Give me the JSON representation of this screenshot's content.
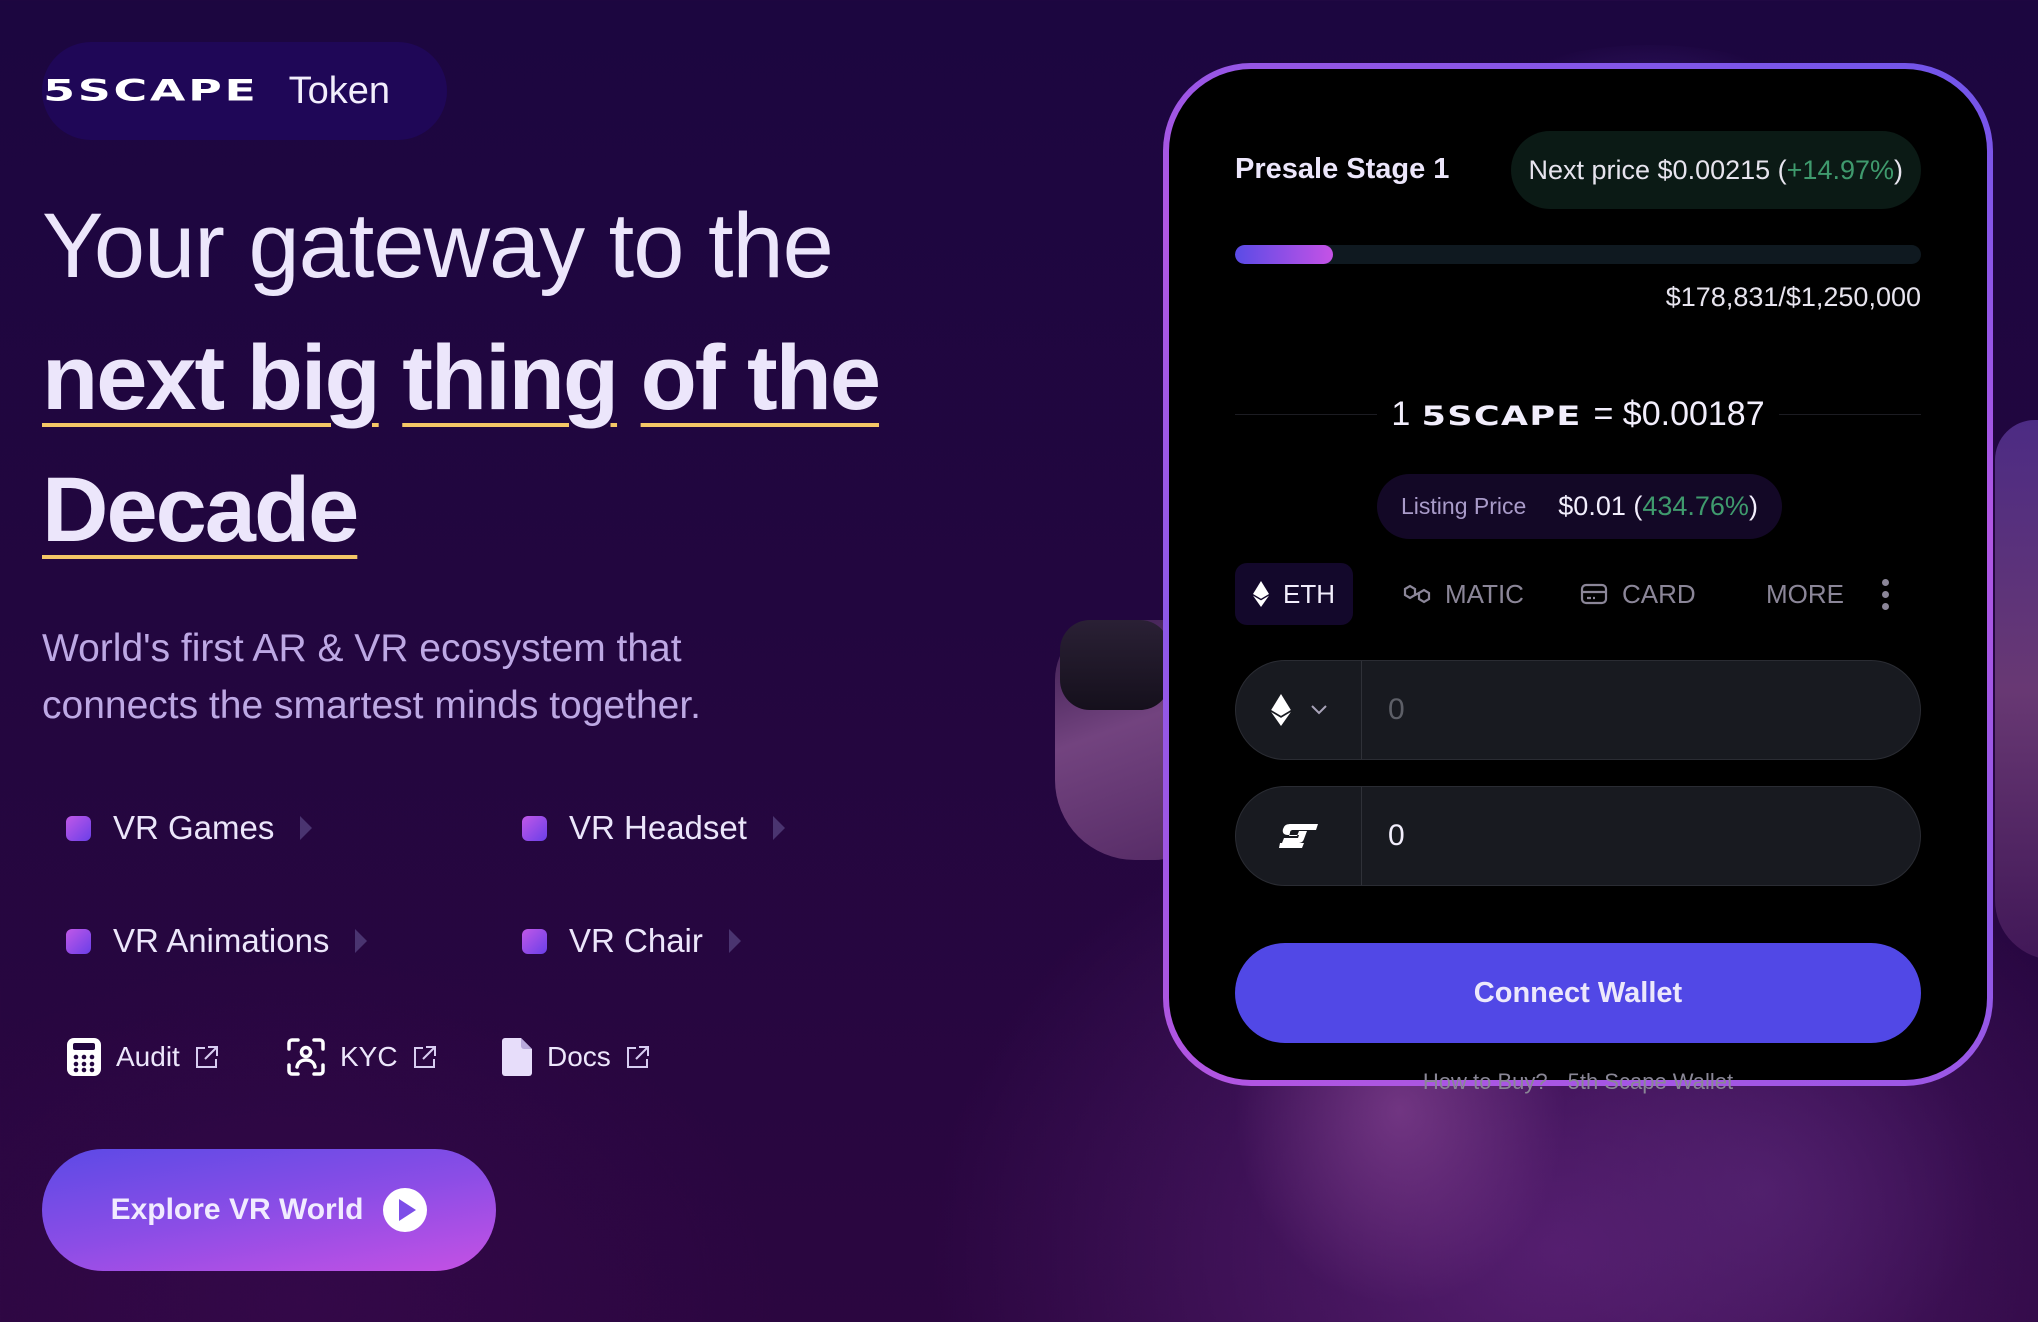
{
  "brand": {
    "logo_mark": "5SCAPE",
    "logo_suffix": "Token"
  },
  "hero": {
    "headline_line1": "Your gateway to the",
    "headline_line2_parts": [
      "next big",
      "thing",
      "of the"
    ],
    "headline_line3": "Decade",
    "description": "World's first AR & VR ecosystem that connects the smartest minds together.",
    "features": [
      {
        "label": "VR Games"
      },
      {
        "label": "VR Headset"
      },
      {
        "label": "VR Animations"
      },
      {
        "label": "VR Chair"
      }
    ],
    "links": [
      {
        "label": "Audit",
        "icon": "calculator-icon"
      },
      {
        "label": "KYC",
        "icon": "face-scan-icon"
      },
      {
        "label": "Docs",
        "icon": "document-icon"
      }
    ],
    "cta_label": "Explore VR World",
    "colors": {
      "underline": "#f4c766",
      "feature_bullet_from": "#c158e8",
      "feature_bullet_to": "#6a3fe8"
    }
  },
  "widget": {
    "stage_title": "Presale Stage 1",
    "next_price_prefix": "Next price $0.00215 (",
    "next_price_change": "+14.97%",
    "next_price_suffix": ")",
    "progress": {
      "raised": 178831,
      "goal": 1250000,
      "fraction": 0.143
    },
    "raised_text": "$178,831/$1,250,000",
    "rate_qty": "1",
    "rate_token": "5SCAPE",
    "rate_value": "= $0.00187",
    "listing_label": "Listing Price",
    "listing_value": "$0.01 (",
    "listing_change": "434.76%",
    "listing_suffix": ")",
    "tabs": [
      {
        "label": "ETH",
        "icon": "ethereum-icon",
        "active": true
      },
      {
        "label": "MATIC",
        "icon": "polygon-icon",
        "active": false
      },
      {
        "label": "CARD",
        "icon": "credit-card-icon",
        "active": false
      },
      {
        "label": "MORE",
        "icon": "",
        "active": false
      }
    ],
    "pay_input": {
      "currency": "ETH",
      "placeholder": "0",
      "value": ""
    },
    "receive_input": {
      "currency": "5SCAPE",
      "value": "0"
    },
    "connect_label": "Connect Wallet",
    "help_links": [
      "How to Buy?",
      "5th Scape Wallet"
    ],
    "colors": {
      "accent": "#5148e6",
      "positive": "#3f9a6d",
      "card_border_from": "#6f55ea",
      "card_border_to": "#b157e3"
    }
  }
}
